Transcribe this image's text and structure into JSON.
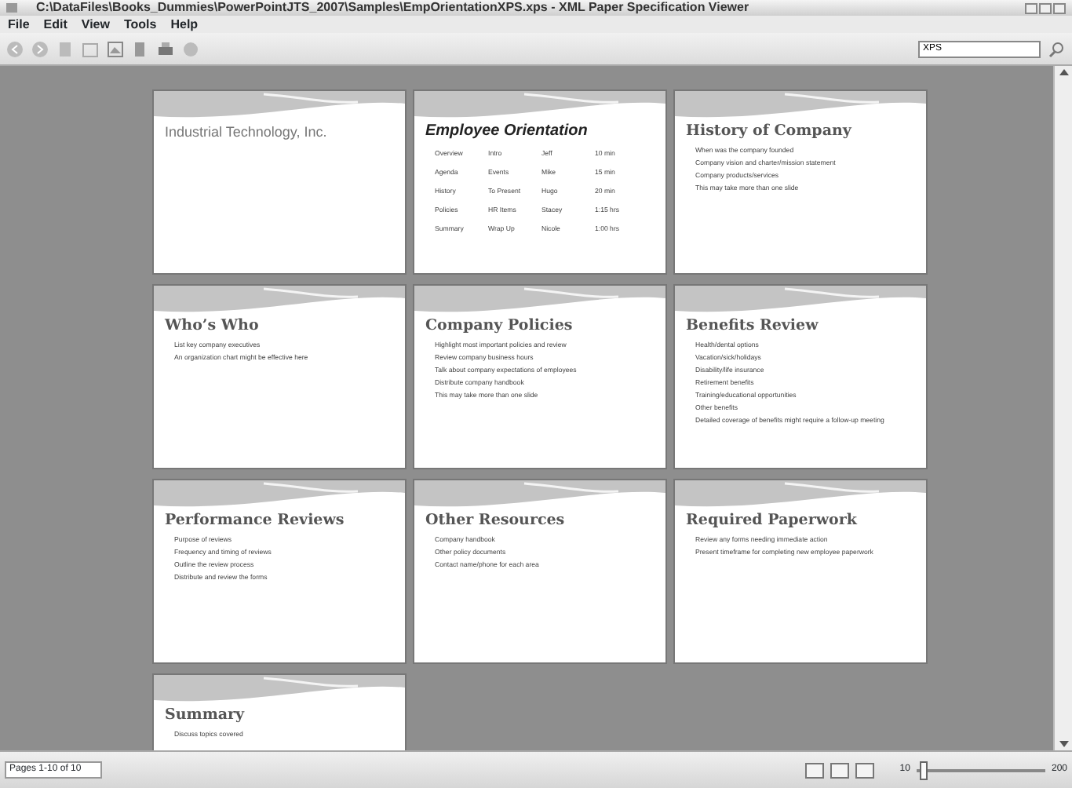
{
  "window": {
    "title": "C:\\DataFiles\\Books_Dummies\\PowerPointJTS_2007\\Samples\\EmpOrientationXPS.xps - XML Paper Specification Viewer"
  },
  "menu": [
    "File",
    "Edit",
    "View",
    "Tools",
    "Help"
  ],
  "search": {
    "value": "XPS"
  },
  "slides": [
    {
      "kind": "title",
      "title": "Industrial Technology, Inc."
    },
    {
      "kind": "table",
      "title": "Employee Orientation",
      "rows": [
        [
          "Overview",
          "Intro",
          "Jeff",
          "10 min"
        ],
        [
          "Agenda",
          "Events",
          "Mike",
          "15 min"
        ],
        [
          "History",
          "To Present",
          "Hugo",
          "20 min"
        ],
        [
          "Policies",
          "HR Items",
          "Stacey",
          "1:15 hrs"
        ],
        [
          "Summary",
          "Wrap Up",
          "Nicole",
          "1:00 hrs"
        ]
      ]
    },
    {
      "kind": "bullets",
      "title": "History of Company",
      "bullets": [
        "When was the company founded",
        "Company vision and charter/mission statement",
        "Company products/services",
        "This may take more than one slide"
      ]
    },
    {
      "kind": "bullets",
      "title": "Who’s Who",
      "bullets": [
        "List key company executives",
        "An organization chart might be effective here"
      ]
    },
    {
      "kind": "bullets",
      "title": "Company Policies",
      "bullets": [
        "Highlight most important policies and review",
        "Review company business hours",
        "Talk about company expectations of employees",
        "Distribute company handbook",
        "This may take more than one slide"
      ]
    },
    {
      "kind": "bullets",
      "title": "Benefits Review",
      "bullets": [
        "Health/dental options",
        "Vacation/sick/holidays",
        "Disability/life insurance",
        "Retirement benefits",
        "Training/educational opportunities",
        "Other benefits",
        "Detailed coverage of benefits might require a follow-up meeting"
      ]
    },
    {
      "kind": "bullets",
      "title": "Performance Reviews",
      "bullets": [
        "Purpose of reviews",
        "Frequency and timing of reviews",
        "Outline the review process",
        "Distribute and review the forms"
      ]
    },
    {
      "kind": "bullets",
      "title": "Other Resources",
      "bullets": [
        "Company handbook",
        "Other policy documents",
        "Contact name/phone for each area"
      ]
    },
    {
      "kind": "bullets",
      "title": "Required Paperwork",
      "bullets": [
        "Review any forms needing immediate action",
        "Present timeframe for completing new employee paperwork"
      ]
    },
    {
      "kind": "bullets",
      "title": "Summary",
      "bullets": [
        "Discuss topics covered"
      ]
    }
  ],
  "status_bar": {
    "pages": "Pages 1-10 of 10",
    "zoom_min": "10",
    "zoom_max": "200",
    "zoom": {
      "level": 0.03
    }
  }
}
